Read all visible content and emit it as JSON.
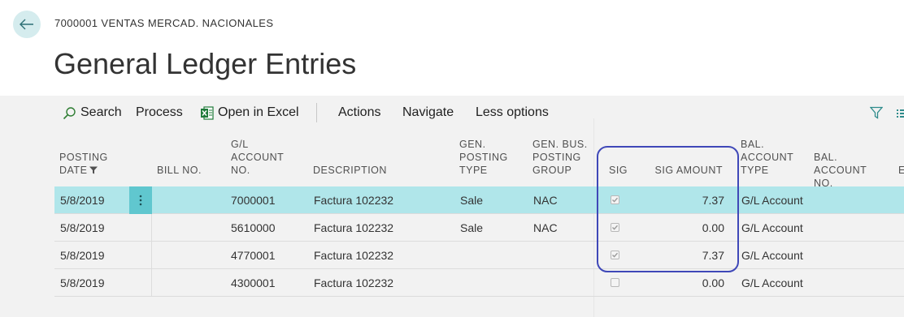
{
  "breadcrumb": "7000001 VENTAS MERCAD. NACIONALES",
  "title": "General Ledger Entries",
  "actions": {
    "search": "Search",
    "process": "Process",
    "open_excel": "Open in Excel",
    "actions": "Actions",
    "navigate": "Navigate",
    "less_options": "Less options"
  },
  "columns": {
    "posting_date": [
      "POSTING",
      "DATE"
    ],
    "bill_no": "BILL NO.",
    "gl_account": [
      "G/L",
      "ACCOUNT",
      "NO."
    ],
    "description": "DESCRIPTION",
    "gen_posting_type": [
      "GEN.",
      "POSTING",
      "TYPE"
    ],
    "gen_bus_group": [
      "GEN. BUS.",
      "POSTING",
      "GROUP"
    ],
    "sig": "SIG",
    "sig_amount": "SIG AMOUNT",
    "bal_account_type": [
      "BAL.",
      "ACCOUNT",
      "TYPE"
    ],
    "bal_account_no": [
      "BAL.",
      "ACCOUNT",
      "NO."
    ],
    "next": "E"
  },
  "rows": [
    {
      "date": "5/8/2019",
      "bill": "",
      "account": "7000001",
      "description": "Factura 102232",
      "gen_type": "Sale",
      "bus_group": "NAC",
      "sig": true,
      "sig_amount": "7.37",
      "bal_type": "G/L Account",
      "bal_no": "",
      "selected": true
    },
    {
      "date": "5/8/2019",
      "bill": "",
      "account": "5610000",
      "description": "Factura 102232",
      "gen_type": "Sale",
      "bus_group": "NAC",
      "sig": true,
      "sig_amount": "0.00",
      "bal_type": "G/L Account",
      "bal_no": "",
      "selected": false
    },
    {
      "date": "5/8/2019",
      "bill": "",
      "account": "4770001",
      "description": "Factura 102232",
      "gen_type": "",
      "bus_group": "",
      "sig": true,
      "sig_amount": "7.37",
      "bal_type": "G/L Account",
      "bal_no": "",
      "selected": false
    },
    {
      "date": "5/8/2019",
      "bill": "",
      "account": "4300001",
      "description": "Factura 102232",
      "gen_type": "",
      "bus_group": "",
      "sig": false,
      "sig_amount": "0.00",
      "bal_type": "G/L Account",
      "bal_no": "",
      "selected": false
    }
  ]
}
